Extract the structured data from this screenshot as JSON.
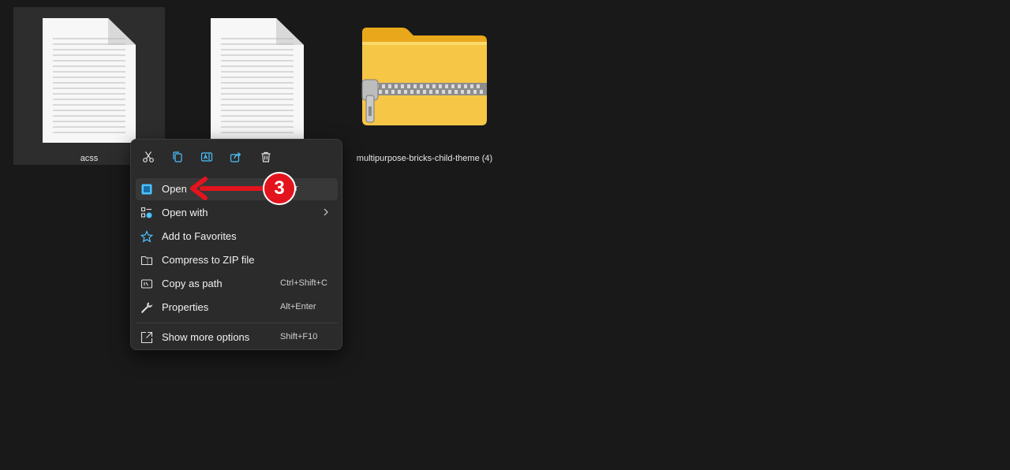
{
  "files": [
    {
      "name": "acss",
      "icon": "text-document-icon",
      "selected": true
    },
    {
      "name": "",
      "icon": "text-document-icon",
      "selected": false
    },
    {
      "name": "multipurpose-bricks-child-theme (4)",
      "icon": "zip-folder-icon",
      "selected": false
    }
  ],
  "context_menu": {
    "quick_actions": [
      {
        "name": "cut-icon"
      },
      {
        "name": "copy-icon"
      },
      {
        "name": "rename-icon"
      },
      {
        "name": "share-icon"
      },
      {
        "name": "delete-icon"
      }
    ],
    "items": [
      {
        "label": "Open",
        "shortcut": "",
        "icon": "open-icon"
      },
      {
        "label": "Open with",
        "shortcut": "",
        "icon": "open-with-icon",
        "submenu": true
      },
      {
        "label": "Add to Favorites",
        "shortcut": "",
        "icon": "star-icon"
      },
      {
        "label": "Compress to ZIP file",
        "shortcut": "",
        "icon": "zip-icon"
      },
      {
        "label": "Copy as path",
        "shortcut": "Ctrl+Shift+C",
        "icon": "copy-path-icon"
      },
      {
        "label": "Properties",
        "shortcut": "Alt+Enter",
        "icon": "wrench-icon"
      },
      {
        "label": "Show more options",
        "shortcut": "Shift+F10",
        "icon": "more-options-icon"
      }
    ],
    "partially_hidden_shortcut": "r"
  },
  "annotation": {
    "step_number": "3",
    "color": "#e3141d"
  },
  "colors": {
    "background": "#191919",
    "menu_bg": "#2b2b2b",
    "accent_blue": "#4cc2ff",
    "folder_yellow": "#f4c542"
  }
}
